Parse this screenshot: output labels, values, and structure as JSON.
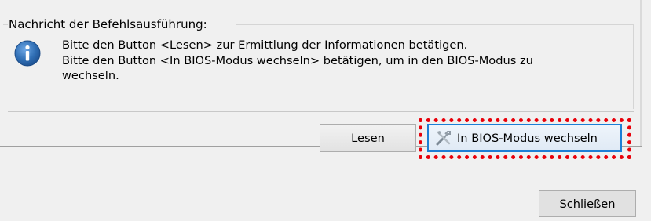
{
  "group": {
    "title": "Nachricht der Befehlsausführung:"
  },
  "message": {
    "icon": "info-icon",
    "lines": [
      "Bitte den Button <Lesen> zur Ermittlung der Informationen betätigen.",
      "Bitte den Button <In BIOS-Modus wechseln> betätigen, um in den BIOS-Modus zu",
      "wechseln."
    ]
  },
  "buttons": {
    "read_label": "Lesen",
    "bios_label": "In BIOS-Modus wechseln",
    "bios_icon": "tools-icon",
    "close_label": "Schließen"
  },
  "colors": {
    "highlight": "#e8000a",
    "focus_border": "#1c7fd6",
    "info_blue": "#2f6eb4"
  }
}
